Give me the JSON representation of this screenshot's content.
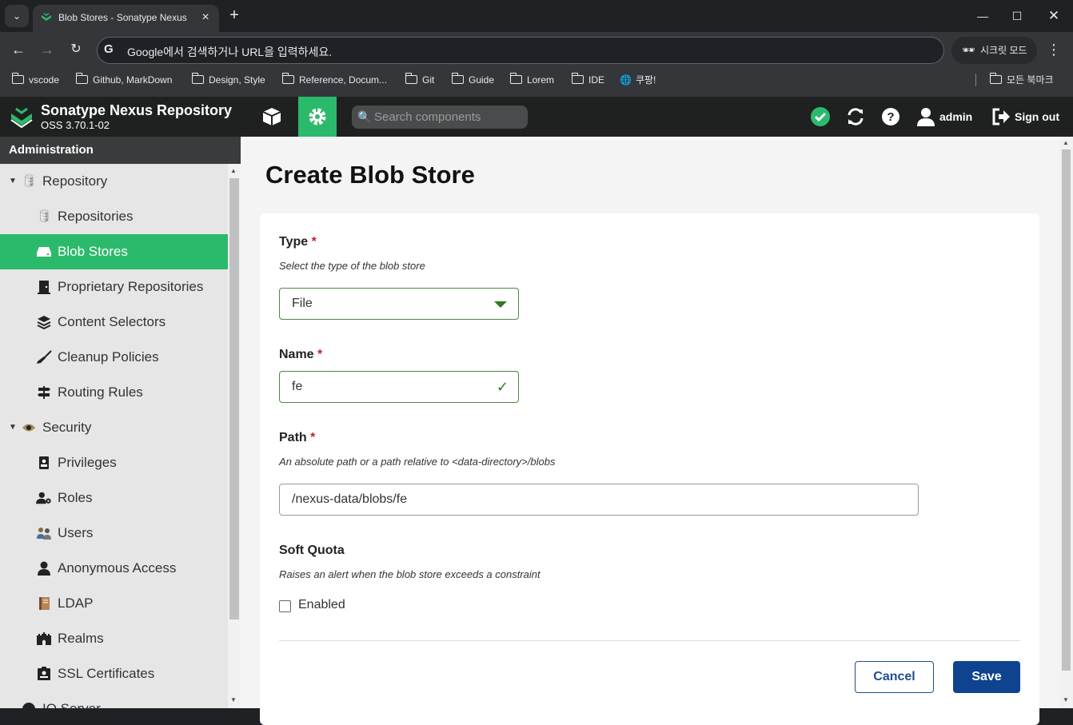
{
  "browser": {
    "tab_title": "Blob Stores - Sonatype Nexus",
    "address_placeholder": "Google에서 검색하거나 URL을 입력하세요.",
    "incognito_label": "시크릿 모드",
    "bookmarks": [
      "vscode",
      "Github, MarkDown",
      "Design, Style",
      "Reference, Docum...",
      "Git",
      "Guide",
      "Lorem",
      "IDE",
      "쿠팡!"
    ],
    "all_bookmarks": "모든 북마크"
  },
  "header": {
    "title": "Sonatype Nexus Repository",
    "version": "OSS 3.70.1-02",
    "search_placeholder": "Search components",
    "user": "admin",
    "sign_out": "Sign out",
    "accent": "#2bba6b"
  },
  "sidebar": {
    "heading": "Administration",
    "items": [
      {
        "label": "Repository",
        "icon": "database-icon",
        "group": true
      },
      {
        "label": "Repositories",
        "icon": "database-icon"
      },
      {
        "label": "Blob Stores",
        "icon": "hard-drive-icon",
        "selected": true
      },
      {
        "label": "Proprietary Repositories",
        "icon": "door-icon"
      },
      {
        "label": "Content Selectors",
        "icon": "layers-icon"
      },
      {
        "label": "Cleanup Policies",
        "icon": "broom-icon"
      },
      {
        "label": "Routing Rules",
        "icon": "signpost-icon"
      },
      {
        "label": "Security",
        "icon": "eye-icon",
        "group": true
      },
      {
        "label": "Privileges",
        "icon": "badge-icon"
      },
      {
        "label": "Roles",
        "icon": "user-gear-icon"
      },
      {
        "label": "Users",
        "icon": "users-icon"
      },
      {
        "label": "Anonymous Access",
        "icon": "user-icon"
      },
      {
        "label": "LDAP",
        "icon": "book-icon"
      },
      {
        "label": "Realms",
        "icon": "castle-icon"
      },
      {
        "label": "SSL Certificates",
        "icon": "certificate-icon"
      },
      {
        "label": "IQ Server",
        "icon": "iq-icon",
        "group": true
      }
    ]
  },
  "form": {
    "title": "Create Blob Store",
    "type_label": "Type",
    "type_desc": "Select the type of the blob store",
    "type_value": "File",
    "name_label": "Name",
    "name_value": "fe",
    "path_label": "Path",
    "path_desc": "An absolute path or a path relative to <data-directory>/blobs",
    "path_value": "/nexus-data/blobs/fe",
    "quota_label": "Soft Quota",
    "quota_desc": "Raises an alert when the blob store exceeds a constraint",
    "quota_enabled_label": "Enabled",
    "quota_enabled": false,
    "required_mark": "*",
    "cancel": "Cancel",
    "save": "Save"
  }
}
